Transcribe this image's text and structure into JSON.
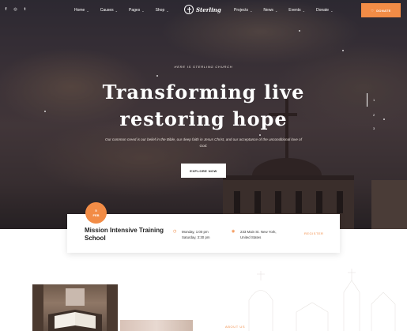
{
  "nav": {
    "social_icons": [
      "facebook-icon",
      "instagram-icon",
      "twitter-icon"
    ],
    "left_menu": [
      {
        "label": "Home"
      },
      {
        "label": "Causes"
      },
      {
        "label": "Pages"
      },
      {
        "label": "Shop"
      }
    ],
    "logo_text": "Sterling",
    "right_menu": [
      {
        "label": "Projects"
      },
      {
        "label": "News"
      },
      {
        "label": "Events"
      },
      {
        "label": "Donate"
      }
    ],
    "donate_button": "DONATE"
  },
  "hero": {
    "eyebrow": "HERE IS STERLING CHURCH",
    "headline_line1": "Transforming live",
    "headline_line2": "restoring hope",
    "lead": "Our common creed is our belief in the Bible, our deep faith in Jesus Christ, and our acceptance of the unconditional love of God.",
    "cta": "EXPLORE NOW",
    "slides": [
      "1",
      "2",
      "3"
    ]
  },
  "event": {
    "badge_day": "5",
    "badge_month": "FEB",
    "title": "Mission Intensive Training School",
    "time_line1": "Monday, 1:00 pm",
    "time_line2": "Saturday, 3:30 pm",
    "place_line1": "233 Main St. New York,",
    "place_line2": "United States",
    "link": "REGISTER"
  },
  "about": {
    "label": "ABOUT US"
  },
  "colors": {
    "accent": "#f28c46",
    "text_dark": "#222222"
  }
}
